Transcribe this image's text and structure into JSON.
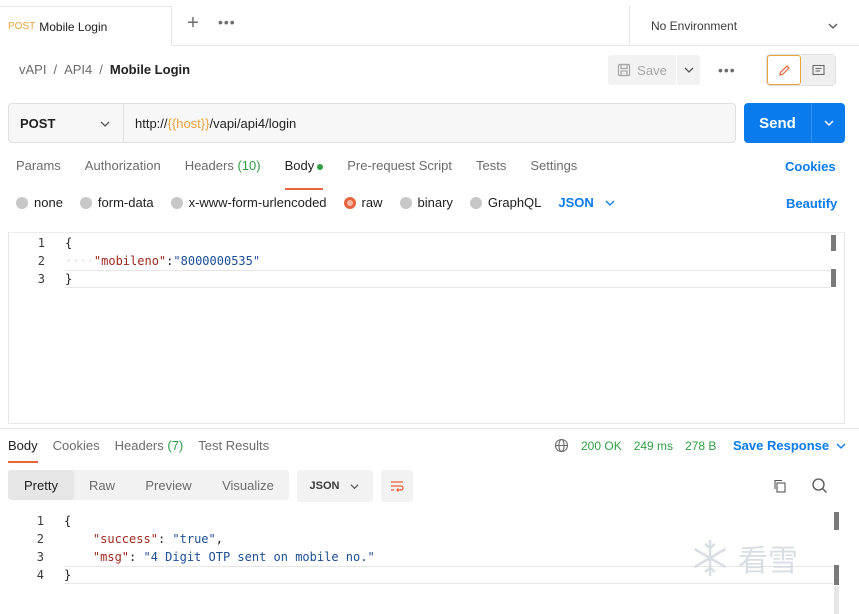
{
  "tabs": {
    "active": {
      "method": "POST",
      "name": "Mobile Login"
    },
    "environment": "No Environment"
  },
  "breadcrumb": {
    "parts": [
      "vAPI",
      "API4"
    ],
    "current": "Mobile Login"
  },
  "toolbar": {
    "save_label": "Save"
  },
  "request": {
    "method": "POST",
    "url_prefix": "http://",
    "url_var": "{{host}}",
    "url_suffix": "/vapi/api4/login",
    "send_label": "Send"
  },
  "request_tabs": {
    "params": "Params",
    "authorization": "Authorization",
    "headers": "Headers",
    "headers_count": "(10)",
    "body": "Body",
    "prerequest": "Pre-request Script",
    "tests": "Tests",
    "settings": "Settings",
    "cookies": "Cookies"
  },
  "body_types": {
    "none": "none",
    "form_data": "form-data",
    "urlencoded": "x-www-form-urlencoded",
    "raw": "raw",
    "binary": "binary",
    "graphql": "GraphQL",
    "format": "JSON",
    "beautify": "Beautify"
  },
  "request_body": {
    "line_numbers": [
      "1",
      "2",
      "3"
    ],
    "open": "{",
    "key": "\"mobileno\"",
    "colon": ":",
    "value": "\"8000000535\"",
    "close": "}"
  },
  "response_tabs": {
    "body": "Body",
    "cookies": "Cookies",
    "headers": "Headers",
    "headers_count": "(7)",
    "test_results": "Test Results"
  },
  "response_meta": {
    "status": "200 OK",
    "time": "249 ms",
    "size": "278 B",
    "save_response": "Save Response"
  },
  "response_view": {
    "pretty": "Pretty",
    "raw": "Raw",
    "preview": "Preview",
    "visualize": "Visualize",
    "format": "JSON"
  },
  "response_body": {
    "line_numbers": [
      "1",
      "2",
      "3",
      "4"
    ],
    "open": "{",
    "key1": "\"success\"",
    "sep1": ": ",
    "val1": "\"true\"",
    "comma": ",",
    "key2": "\"msg\"",
    "sep2": ": ",
    "val2": "\"4 Digit OTP sent on mobile no.\"",
    "close": "}"
  },
  "watermark": {
    "text": "看雪"
  },
  "colors": {
    "accent": "#e8643c",
    "primary": "#097bed",
    "success": "#2f9e44",
    "method_post": "#e8a33c"
  }
}
